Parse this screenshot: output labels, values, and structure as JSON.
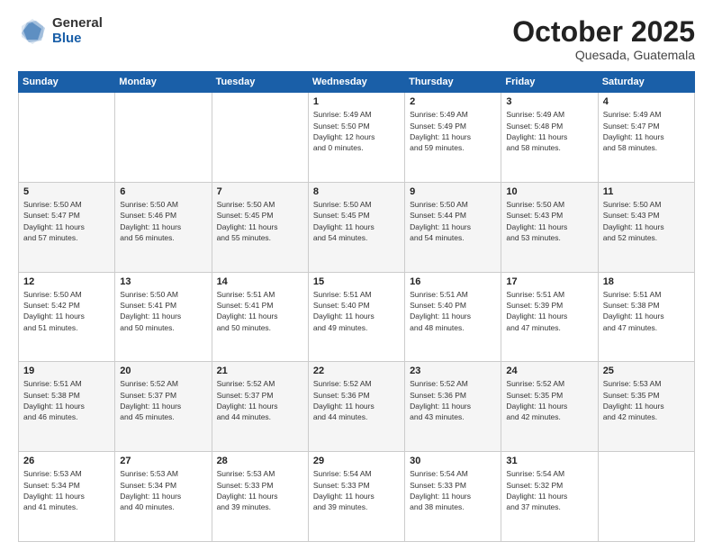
{
  "header": {
    "logo_general": "General",
    "logo_blue": "Blue",
    "title": "October 2025",
    "subtitle": "Quesada, Guatemala"
  },
  "days_of_week": [
    "Sunday",
    "Monday",
    "Tuesday",
    "Wednesday",
    "Thursday",
    "Friday",
    "Saturday"
  ],
  "weeks": [
    [
      {
        "day": "",
        "info": ""
      },
      {
        "day": "",
        "info": ""
      },
      {
        "day": "",
        "info": ""
      },
      {
        "day": "1",
        "info": "Sunrise: 5:49 AM\nSunset: 5:50 PM\nDaylight: 12 hours\nand 0 minutes."
      },
      {
        "day": "2",
        "info": "Sunrise: 5:49 AM\nSunset: 5:49 PM\nDaylight: 11 hours\nand 59 minutes."
      },
      {
        "day": "3",
        "info": "Sunrise: 5:49 AM\nSunset: 5:48 PM\nDaylight: 11 hours\nand 58 minutes."
      },
      {
        "day": "4",
        "info": "Sunrise: 5:49 AM\nSunset: 5:47 PM\nDaylight: 11 hours\nand 58 minutes."
      }
    ],
    [
      {
        "day": "5",
        "info": "Sunrise: 5:50 AM\nSunset: 5:47 PM\nDaylight: 11 hours\nand 57 minutes."
      },
      {
        "day": "6",
        "info": "Sunrise: 5:50 AM\nSunset: 5:46 PM\nDaylight: 11 hours\nand 56 minutes."
      },
      {
        "day": "7",
        "info": "Sunrise: 5:50 AM\nSunset: 5:45 PM\nDaylight: 11 hours\nand 55 minutes."
      },
      {
        "day": "8",
        "info": "Sunrise: 5:50 AM\nSunset: 5:45 PM\nDaylight: 11 hours\nand 54 minutes."
      },
      {
        "day": "9",
        "info": "Sunrise: 5:50 AM\nSunset: 5:44 PM\nDaylight: 11 hours\nand 54 minutes."
      },
      {
        "day": "10",
        "info": "Sunrise: 5:50 AM\nSunset: 5:43 PM\nDaylight: 11 hours\nand 53 minutes."
      },
      {
        "day": "11",
        "info": "Sunrise: 5:50 AM\nSunset: 5:43 PM\nDaylight: 11 hours\nand 52 minutes."
      }
    ],
    [
      {
        "day": "12",
        "info": "Sunrise: 5:50 AM\nSunset: 5:42 PM\nDaylight: 11 hours\nand 51 minutes."
      },
      {
        "day": "13",
        "info": "Sunrise: 5:50 AM\nSunset: 5:41 PM\nDaylight: 11 hours\nand 50 minutes."
      },
      {
        "day": "14",
        "info": "Sunrise: 5:51 AM\nSunset: 5:41 PM\nDaylight: 11 hours\nand 50 minutes."
      },
      {
        "day": "15",
        "info": "Sunrise: 5:51 AM\nSunset: 5:40 PM\nDaylight: 11 hours\nand 49 minutes."
      },
      {
        "day": "16",
        "info": "Sunrise: 5:51 AM\nSunset: 5:40 PM\nDaylight: 11 hours\nand 48 minutes."
      },
      {
        "day": "17",
        "info": "Sunrise: 5:51 AM\nSunset: 5:39 PM\nDaylight: 11 hours\nand 47 minutes."
      },
      {
        "day": "18",
        "info": "Sunrise: 5:51 AM\nSunset: 5:38 PM\nDaylight: 11 hours\nand 47 minutes."
      }
    ],
    [
      {
        "day": "19",
        "info": "Sunrise: 5:51 AM\nSunset: 5:38 PM\nDaylight: 11 hours\nand 46 minutes."
      },
      {
        "day": "20",
        "info": "Sunrise: 5:52 AM\nSunset: 5:37 PM\nDaylight: 11 hours\nand 45 minutes."
      },
      {
        "day": "21",
        "info": "Sunrise: 5:52 AM\nSunset: 5:37 PM\nDaylight: 11 hours\nand 44 minutes."
      },
      {
        "day": "22",
        "info": "Sunrise: 5:52 AM\nSunset: 5:36 PM\nDaylight: 11 hours\nand 44 minutes."
      },
      {
        "day": "23",
        "info": "Sunrise: 5:52 AM\nSunset: 5:36 PM\nDaylight: 11 hours\nand 43 minutes."
      },
      {
        "day": "24",
        "info": "Sunrise: 5:52 AM\nSunset: 5:35 PM\nDaylight: 11 hours\nand 42 minutes."
      },
      {
        "day": "25",
        "info": "Sunrise: 5:53 AM\nSunset: 5:35 PM\nDaylight: 11 hours\nand 42 minutes."
      }
    ],
    [
      {
        "day": "26",
        "info": "Sunrise: 5:53 AM\nSunset: 5:34 PM\nDaylight: 11 hours\nand 41 minutes."
      },
      {
        "day": "27",
        "info": "Sunrise: 5:53 AM\nSunset: 5:34 PM\nDaylight: 11 hours\nand 40 minutes."
      },
      {
        "day": "28",
        "info": "Sunrise: 5:53 AM\nSunset: 5:33 PM\nDaylight: 11 hours\nand 39 minutes."
      },
      {
        "day": "29",
        "info": "Sunrise: 5:54 AM\nSunset: 5:33 PM\nDaylight: 11 hours\nand 39 minutes."
      },
      {
        "day": "30",
        "info": "Sunrise: 5:54 AM\nSunset: 5:33 PM\nDaylight: 11 hours\nand 38 minutes."
      },
      {
        "day": "31",
        "info": "Sunrise: 5:54 AM\nSunset: 5:32 PM\nDaylight: 11 hours\nand 37 minutes."
      },
      {
        "day": "",
        "info": ""
      }
    ]
  ]
}
